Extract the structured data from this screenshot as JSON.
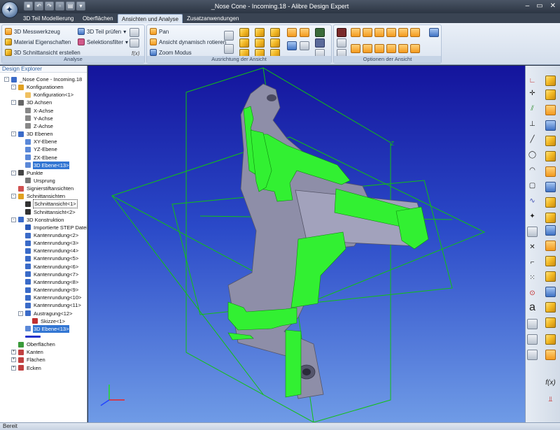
{
  "window": {
    "title": "_Nose Cone - Incoming.18 - Alibre Design Expert"
  },
  "tabs": [
    {
      "label": "3D Teil Modellierung"
    },
    {
      "label": "Oberflächen"
    },
    {
      "label": "Ansichten und Analyse",
      "active": true
    },
    {
      "label": "Zusatzanwendungen"
    }
  ],
  "ribbon": {
    "analyse": {
      "label": "Analyse",
      "measure": "3D Messwerkzeug",
      "inspect": "3D Teil prüfen",
      "material": "Material Eigenschaften",
      "selection_filter": "Selektionsfilter",
      "section_view": "3D Schnittansicht erstellen",
      "fx": "f(x)"
    },
    "orientation": {
      "label": "Ausrichtung der Ansicht",
      "pan": "Pan",
      "rotate": "Ansicht dynamisch rotieren",
      "zoom": "Zoom Modus"
    },
    "view_options": {
      "label": "Optionen der Ansicht"
    }
  },
  "explorer": {
    "title": "Design Explorer",
    "rows": [
      {
        "label": "_Nose Cone - Incoming.18",
        "icon": "part-icon",
        "level": 0,
        "exp": "-"
      },
      {
        "label": "Konfigurationen",
        "icon": "config-icon",
        "level": 1,
        "exp": "-"
      },
      {
        "label": "Konfiguration<1>",
        "icon": "config-item-icon",
        "level": 2
      },
      {
        "label": "3D Achsen",
        "icon": "axes-icon",
        "level": 1,
        "exp": "-"
      },
      {
        "label": "X-Achse",
        "icon": "axis-icon",
        "level": 2
      },
      {
        "label": "Y-Achse",
        "icon": "axis-icon",
        "level": 2
      },
      {
        "label": "Z-Achse",
        "icon": "axis-icon",
        "level": 2
      },
      {
        "label": "3D Ebenen",
        "icon": "planes-icon",
        "level": 1,
        "exp": "-"
      },
      {
        "label": "XY-Ebene",
        "icon": "plane-icon",
        "level": 2
      },
      {
        "label": "YZ-Ebene",
        "icon": "plane-icon",
        "level": 2
      },
      {
        "label": "ZX-Ebene",
        "icon": "plane-icon",
        "level": 2
      },
      {
        "label": "3D Ebene<13>",
        "icon": "plane-icon",
        "level": 2,
        "selected": true
      },
      {
        "label": "Punkte",
        "icon": "points-icon",
        "level": 1,
        "exp": "-"
      },
      {
        "label": "Ursprung",
        "icon": "origin-icon",
        "level": 2
      },
      {
        "label": "Signierstiftansichten",
        "icon": "redline-icon",
        "level": 1
      },
      {
        "label": "Schnittansichten",
        "icon": "section-folder-icon",
        "level": 1,
        "exp": "-"
      },
      {
        "label": "Schnittansicht<1>",
        "icon": "section-icon",
        "level": 2,
        "boxed": true
      },
      {
        "label": "Schnittansicht<2>",
        "icon": "section-icon",
        "level": 2
      },
      {
        "label": "3D Konstruktion",
        "icon": "construction-icon",
        "level": 1,
        "exp": "-"
      },
      {
        "label": "Importierte STEP Datei",
        "icon": "step-import-icon",
        "level": 2
      },
      {
        "label": "Kantenrundung<2>",
        "icon": "fillet-icon",
        "level": 2
      },
      {
        "label": "Kantenrundung<3>",
        "icon": "fillet-icon",
        "level": 2
      },
      {
        "label": "Kantenrundung<4>",
        "icon": "fillet-icon",
        "level": 2
      },
      {
        "label": "Kantenrundung<5>",
        "icon": "fillet-icon",
        "level": 2
      },
      {
        "label": "Kantenrundung<6>",
        "icon": "fillet-icon",
        "level": 2
      },
      {
        "label": "Kantenrundung<7>",
        "icon": "fillet-icon",
        "level": 2
      },
      {
        "label": "Kantenrundung<8>",
        "icon": "fillet-icon",
        "level": 2
      },
      {
        "label": "Kantenrundung<9>",
        "icon": "fillet-icon",
        "level": 2
      },
      {
        "label": "Kantenrundung<10>",
        "icon": "fillet-icon",
        "level": 2
      },
      {
        "label": "Kantenrundung<11>",
        "icon": "fillet-icon",
        "level": 2
      },
      {
        "label": "Austragung<12>",
        "icon": "extrude-icon",
        "level": 2,
        "exp": "-"
      },
      {
        "label": "Skizze<1>",
        "icon": "sketch-icon",
        "level": 3
      },
      {
        "label": "3D Ebene<13>",
        "icon": "plane-icon",
        "level": 2,
        "selected": true
      },
      {
        "label": "",
        "icon": "rollback-marker-icon",
        "level": 2
      },
      {
        "label": "Oberflächen",
        "icon": "surfaces-icon",
        "level": 1
      },
      {
        "label": "Kanten",
        "icon": "edges-icon",
        "level": 1,
        "exp": "+"
      },
      {
        "label": "Flächen",
        "icon": "faces-icon",
        "level": 1,
        "exp": "+"
      },
      {
        "label": "Ecken",
        "icon": "vertices-icon",
        "level": 1,
        "exp": "+"
      }
    ]
  },
  "viewport": {
    "plane_label": "Z",
    "colors": {
      "section_fill": "#32f032",
      "part_body": "#8e8ea8",
      "plane_lines": "#11c211",
      "bg_top": "#14149c",
      "bg_bottom": "#6f9be6"
    }
  },
  "right_toolbar": {
    "fx_label": "f(x)",
    "text_tool_label": "a"
  },
  "status": {
    "text": "Bereit"
  }
}
